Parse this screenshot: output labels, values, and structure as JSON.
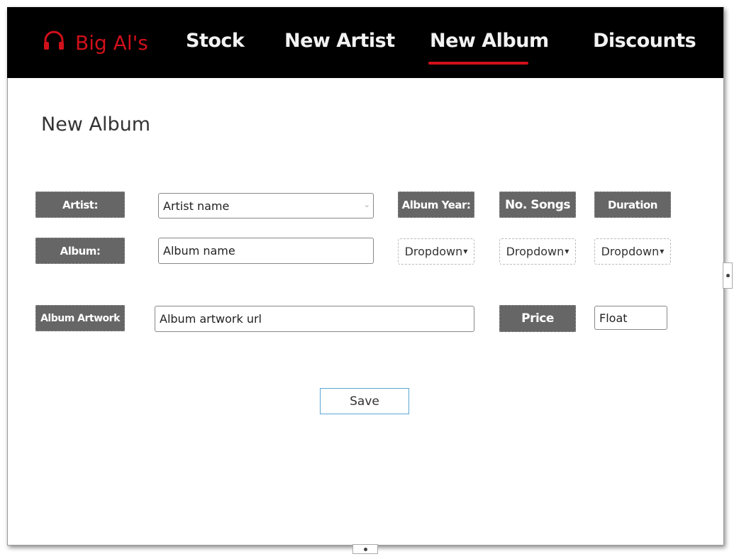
{
  "nav": {
    "brand": "Big Al's",
    "brand_icon": "headphones-icon",
    "items": [
      "Stock",
      "New Artist",
      "New Album",
      "Discounts"
    ],
    "active": "New Album",
    "accent_color": "#d0101a"
  },
  "page_title": "New Album",
  "form": {
    "artist_label": "Artist:",
    "artist_placeholder": "Artist name",
    "album_label": "Album:",
    "album_placeholder": "Album name",
    "artwork_label": "Album Artwork",
    "artwork_placeholder": "Album artwork url",
    "year_label": "Album Year:",
    "songs_label": "No. Songs",
    "duration_label": "Duration",
    "year_value": "Dropdown",
    "songs_value": "Dropdown",
    "duration_value": "Dropdown",
    "price_label": "Price",
    "price_placeholder": "Float",
    "save_label": "Save"
  }
}
